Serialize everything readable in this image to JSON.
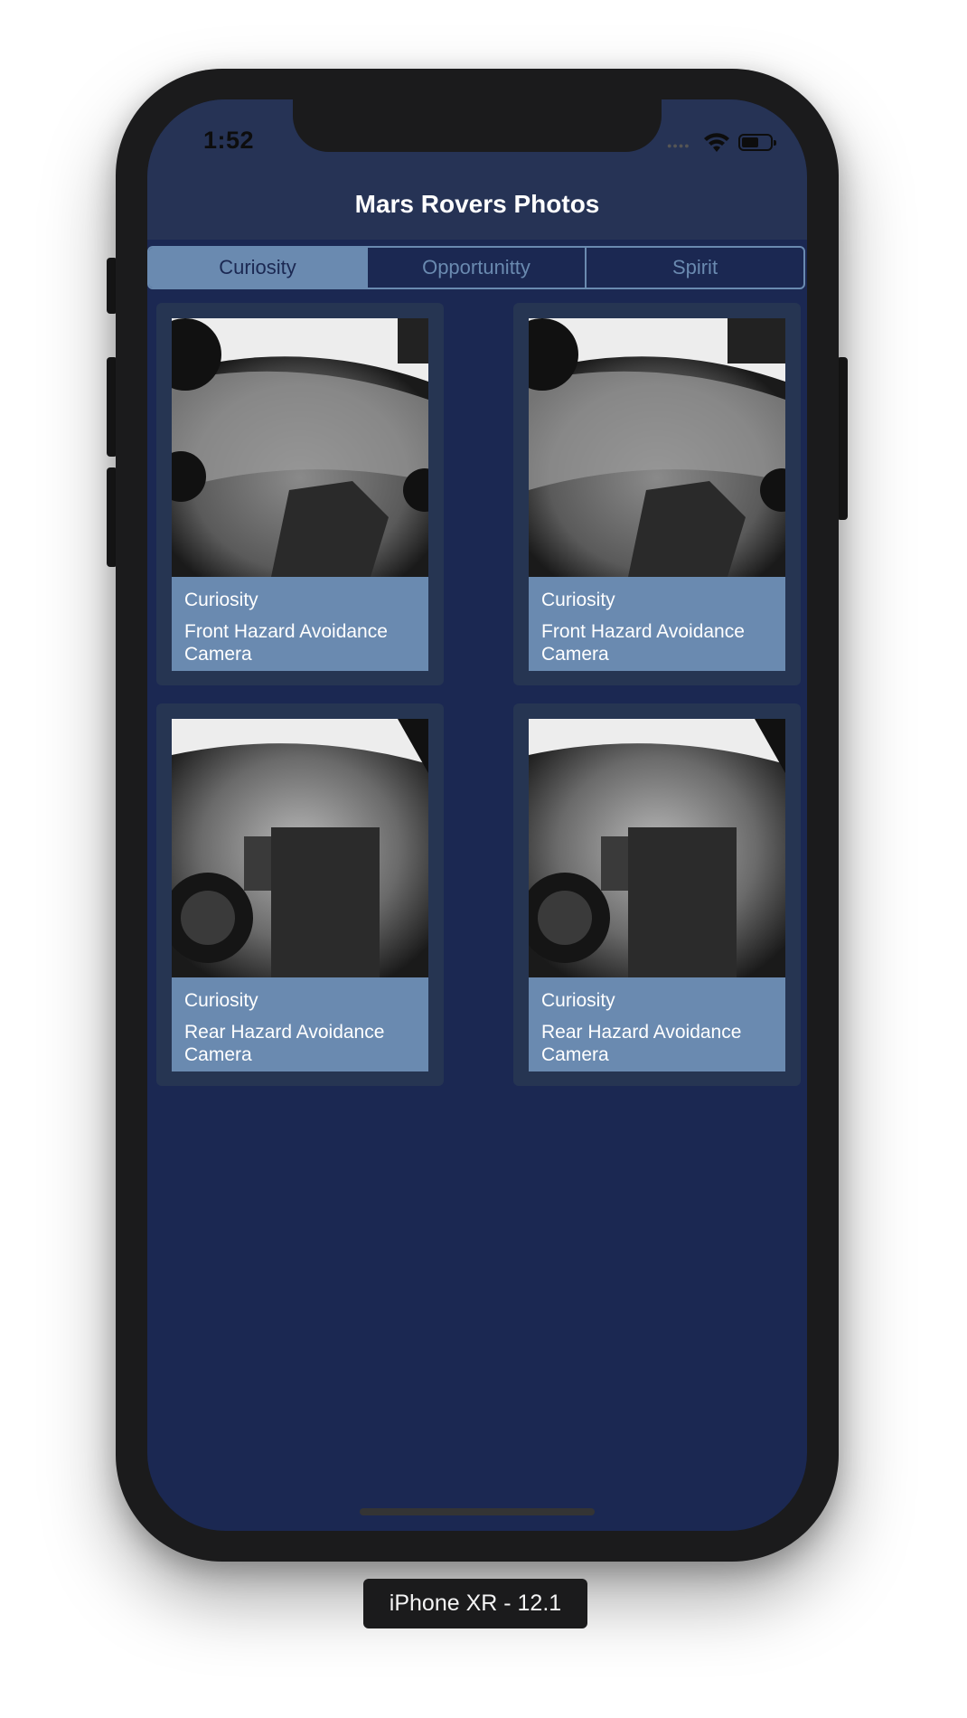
{
  "device": {
    "label": "iPhone XR - 12.1"
  },
  "status_bar": {
    "time": "1:52"
  },
  "nav": {
    "title": "Mars Rovers Photos"
  },
  "segments": [
    {
      "label": "Curiosity",
      "selected": true
    },
    {
      "label": "Opportunitty",
      "selected": false
    },
    {
      "label": "Spirit",
      "selected": false
    }
  ],
  "photos": [
    {
      "rover": "Curiosity",
      "camera": "Front Hazard Avoidance Camera"
    },
    {
      "rover": "Curiosity",
      "camera": "Front Hazard Avoidance Camera"
    },
    {
      "rover": "Curiosity",
      "camera": "Rear Hazard Avoidance Camera"
    },
    {
      "rover": "Curiosity",
      "camera": "Rear Hazard Avoidance Camera"
    }
  ],
  "colors": {
    "background": "#1b2852",
    "bar": "#263355",
    "accent": "#6a8ab0",
    "card": "#263552"
  }
}
